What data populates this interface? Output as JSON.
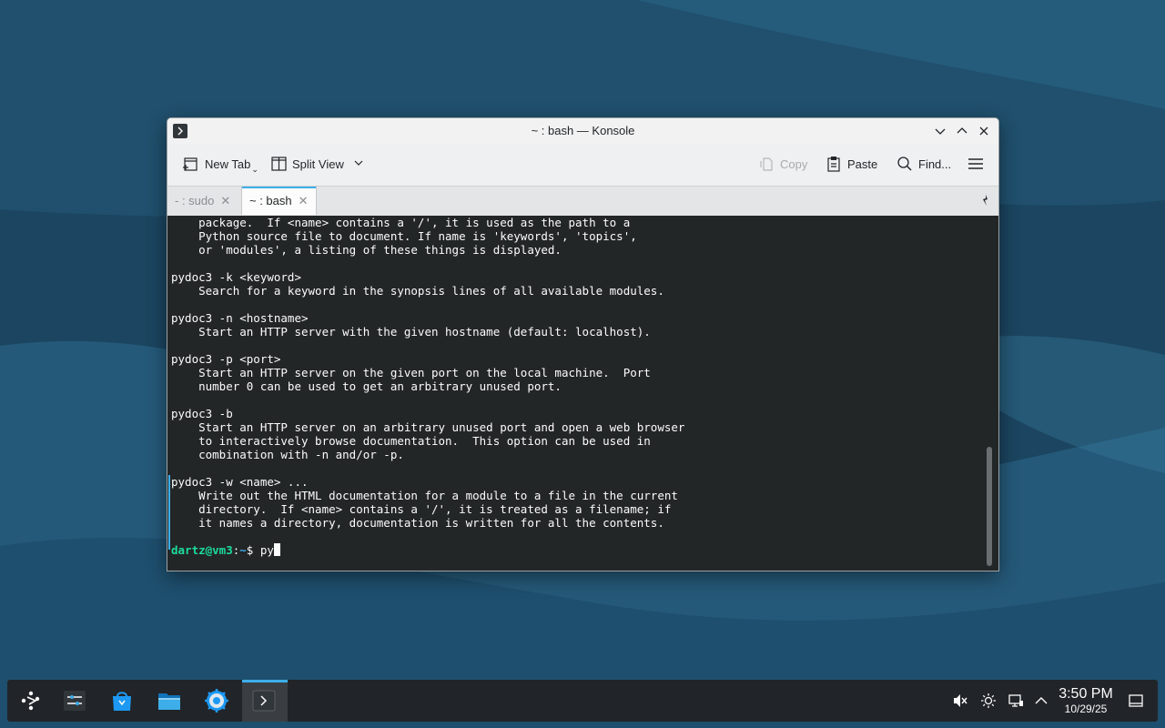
{
  "window": {
    "title": "~ : bash — Konsole"
  },
  "toolbar": {
    "new_tab_label": "New Tab",
    "split_view_label": "Split View",
    "copy_label": "Copy",
    "paste_label": "Paste",
    "find_label": "Find..."
  },
  "tabs": [
    {
      "label": "- : sudo",
      "active": false
    },
    {
      "label": "~ : bash",
      "active": true
    }
  ],
  "terminal": {
    "lines": [
      "    package.  If <name> contains a '/', it is used as the path to a",
      "    Python source file to document. If name is 'keywords', 'topics',",
      "    or 'modules', a listing of these things is displayed.",
      "",
      "pydoc3 -k <keyword>",
      "    Search for a keyword in the synopsis lines of all available modules.",
      "",
      "pydoc3 -n <hostname>",
      "    Start an HTTP server with the given hostname (default: localhost).",
      "",
      "pydoc3 -p <port>",
      "    Start an HTTP server on the given port on the local machine.  Port",
      "    number 0 can be used to get an arbitrary unused port.",
      "",
      "pydoc3 -b",
      "    Start an HTTP server on an arbitrary unused port and open a web browser",
      "    to interactively browse documentation.  This option can be used in",
      "    combination with -n and/or -p.",
      "",
      "pydoc3 -w <name> ...",
      "    Write out the HTML documentation for a module to a file in the current",
      "    directory.  If <name> contains a '/', it is treated as a filename; if",
      "    it names a directory, documentation is written for all the contents.",
      ""
    ],
    "prompt_user": "dartz@vm3",
    "prompt_sep": ":",
    "prompt_path": "~",
    "prompt_symbol": "$ ",
    "input": "py"
  },
  "taskbar": {
    "items": [
      "application-launcher-icon",
      "system-settings-icon",
      "discover-store-icon",
      "file-manager-icon",
      "settings-gear-icon",
      "konsole-icon"
    ],
    "clock_time": "3:50 PM",
    "clock_date": "10/29/25"
  },
  "colors": {
    "accent": "#3daee9",
    "terminal_bg": "#232627",
    "prompt_user": "#1cdc9a"
  }
}
